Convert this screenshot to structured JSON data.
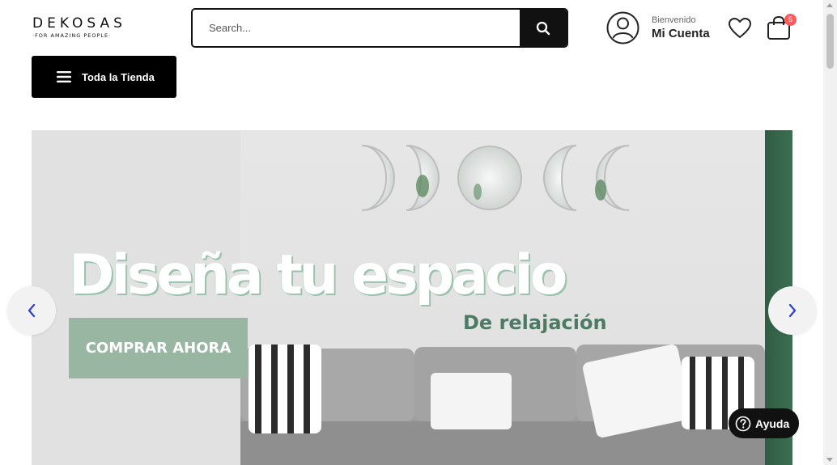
{
  "header": {
    "logo": {
      "name": "DEKOSAS",
      "tagline": "·FOR AMAZING PEOPLE·"
    },
    "search": {
      "placeholder": "Search...",
      "value": ""
    },
    "account": {
      "welcome": "Bienvenido",
      "label": "Mi Cuenta"
    },
    "cart": {
      "count": "5"
    }
  },
  "nav": {
    "store_label": "Toda la Tienda"
  },
  "banner": {
    "title": "Diseña tu espacio",
    "subtitle": "De relajación",
    "cta_label": "COMPRAR AHORA"
  },
  "help": {
    "label": "Ayuda"
  },
  "colors": {
    "dark": "#111111",
    "accent_green": "#98b6a2",
    "text_green": "#4e7a64",
    "badge": "#ff5a5a",
    "arrow": "#2a3fd1"
  },
  "icons": [
    "search-icon",
    "user-icon",
    "heart-icon",
    "shopping-bag-icon",
    "menu-icon",
    "chevron-left-icon",
    "chevron-right-icon",
    "question-icon"
  ]
}
